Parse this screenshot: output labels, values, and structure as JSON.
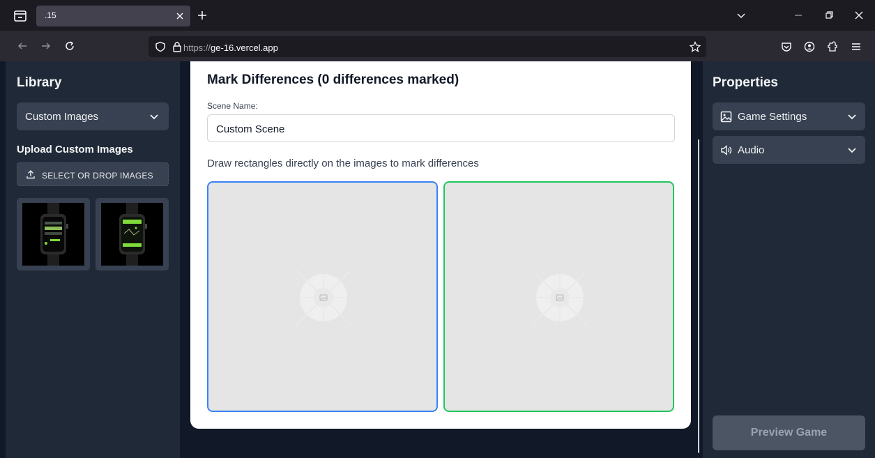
{
  "browser": {
    "tab_title": ".15",
    "url_protocol": "https://",
    "url_domain": "ge-16.vercel.app"
  },
  "library": {
    "title": "Library",
    "dropdown_value": "Custom Images",
    "upload_heading": "Upload Custom Images",
    "upload_button": "SELECT OR DROP IMAGES"
  },
  "editor": {
    "title": "Mark Differences (0 differences marked)",
    "scene_label": "Scene Name:",
    "scene_value": "Custom Scene",
    "instructions": "Draw rectangles directly on the images to mark differences",
    "left_border_color": "#3b82f6",
    "right_border_color": "#22c55e"
  },
  "properties": {
    "title": "Properties",
    "items": [
      {
        "label": "Game Settings",
        "icon": "image-icon"
      },
      {
        "label": "Audio",
        "icon": "speaker-icon"
      }
    ],
    "preview_button": "Preview Game"
  }
}
